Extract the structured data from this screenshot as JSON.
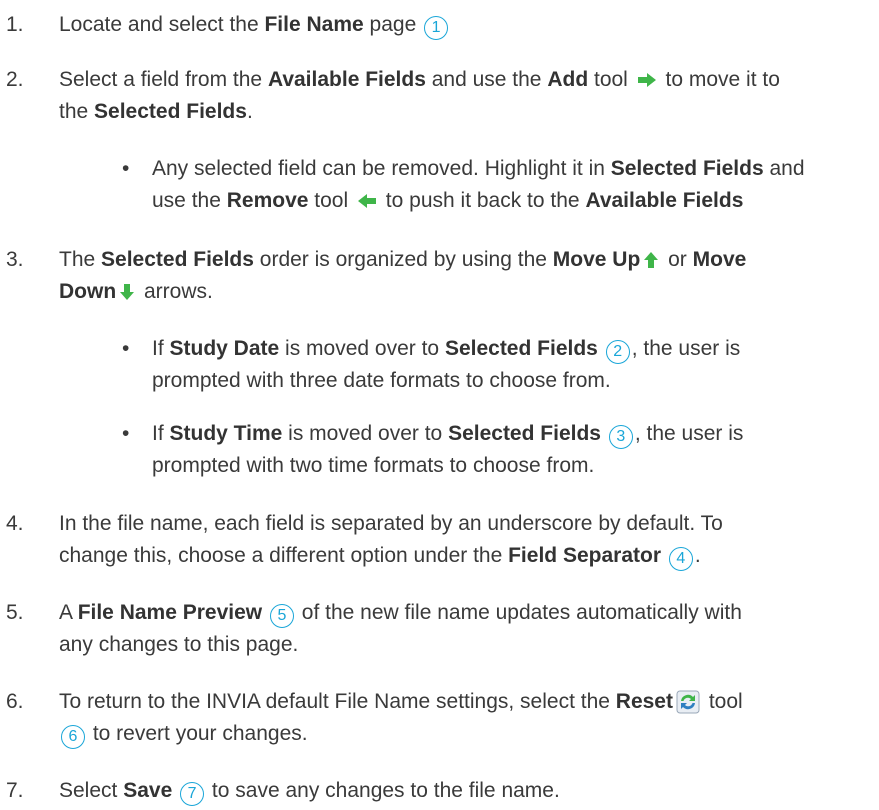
{
  "steps": [
    {
      "num": "1.",
      "a": "Locate and select the ",
      "b": "File Name",
      "c": " page ",
      "circle": "1"
    },
    {
      "num": "2.",
      "a": "Select a field from the ",
      "b": "Available Fields",
      "c": " and use the ",
      "d": "Add",
      "e": " tool ",
      "f": " to move it to",
      "g": "the ",
      "h": "Selected Fields",
      "i": "."
    },
    {
      "bullet": "•",
      "a": "Any selected field can be removed. Highlight it in ",
      "b": "Selected Fields",
      "c": " and",
      "d": "use the ",
      "e": "Remove",
      "f": " tool ",
      "g": " to push it back to the ",
      "h": "Available Fields"
    },
    {
      "num": "3.",
      "a": "The ",
      "b": "Selected Fields",
      "c": " order is organized by using the ",
      "d": "Move Up",
      "e": " or ",
      "f": "Move",
      "g": "Down",
      "h": " arrows."
    },
    {
      "bullet": "•",
      "a": "If ",
      "b": "Study Date",
      "c": " is moved over to ",
      "d": "Selected Fields",
      "circle": "2",
      "e": ", the user is",
      "f": "prompted with three date formats to choose from."
    },
    {
      "bullet": "•",
      "a": "If ",
      "b": "Study Time",
      "c": " is moved over to ",
      "d": "Selected Fields",
      "circle": "3",
      "e": ", the user is",
      "f": "prompted with two time formats to choose from."
    },
    {
      "num": "4.",
      "a": "In the file name, each field is separated by an underscore by default. To",
      "b": "change this, choose a different option under the ",
      "c": "Field Separator",
      "circle": "4",
      "d": "."
    },
    {
      "num": "5.",
      "a": "A ",
      "b": "File Name Preview",
      "circle": "5",
      "c": " of the new file name updates automatically with",
      "d": "any changes to this page."
    },
    {
      "num": "6.",
      "a": "To return to the INVIA default File Name settings, select the ",
      "b": "Reset",
      "c": " tool",
      "circle": "6",
      "d": " to revert your changes."
    },
    {
      "num": "7.",
      "a": "Select ",
      "b": "Save",
      "circle": "7",
      "c": " to save any changes to the file name."
    }
  ],
  "icons": {
    "add": "arrow-right-icon",
    "remove": "arrow-left-icon",
    "move_up": "arrow-up-icon",
    "move_down": "arrow-down-icon",
    "reset": "reset-icon"
  },
  "colors": {
    "arrow": "#3fb549",
    "callout": "#1aa6d8",
    "text": "#3a3a3a"
  }
}
